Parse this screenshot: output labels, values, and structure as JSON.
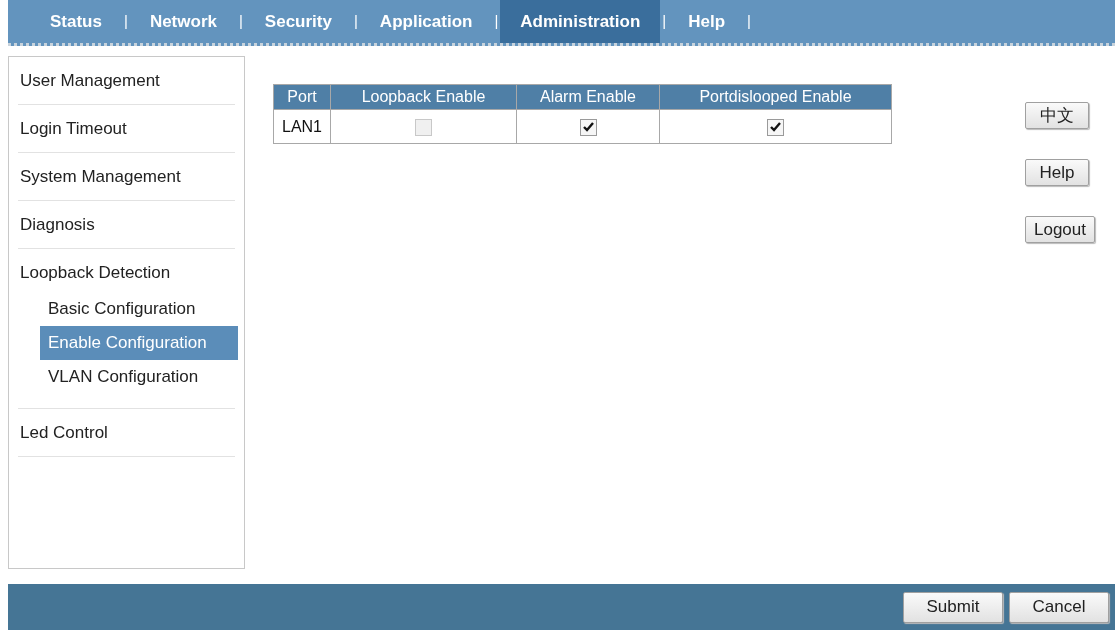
{
  "nav": {
    "tabs": [
      {
        "label": "Status",
        "selected": false,
        "separator": "|"
      },
      {
        "label": "Network",
        "selected": false,
        "separator": "|"
      },
      {
        "label": "Security",
        "selected": false,
        "separator": "|"
      },
      {
        "label": "Application",
        "selected": false,
        "separator": "|"
      },
      {
        "label": "Administration",
        "selected": true,
        "separator": "|"
      },
      {
        "label": "Help",
        "selected": false,
        "separator": "|"
      }
    ]
  },
  "sidebar": {
    "items": [
      {
        "label": "User Management"
      },
      {
        "label": "Login Timeout"
      },
      {
        "label": "System Management"
      },
      {
        "label": "Diagnosis"
      },
      {
        "label": "Loopback Detection",
        "children": [
          {
            "label": "Basic Configuration",
            "selected": false
          },
          {
            "label": "Enable Configuration",
            "selected": true
          },
          {
            "label": "VLAN Configuration",
            "selected": false
          }
        ]
      },
      {
        "label": "Led Control"
      }
    ]
  },
  "table": {
    "columns": [
      "Port",
      "Loopback Enable",
      "Alarm Enable",
      "Portdislooped Enable"
    ],
    "rows": [
      {
        "port": "LAN1",
        "checks": [
          {
            "checked": false,
            "disabled": true
          },
          {
            "checked": true,
            "disabled": false
          },
          {
            "checked": true,
            "disabled": false
          }
        ]
      }
    ]
  },
  "side_buttons": [
    "中文",
    "Help",
    "Logout"
  ],
  "footer_buttons": [
    "Submit",
    "Cancel"
  ]
}
